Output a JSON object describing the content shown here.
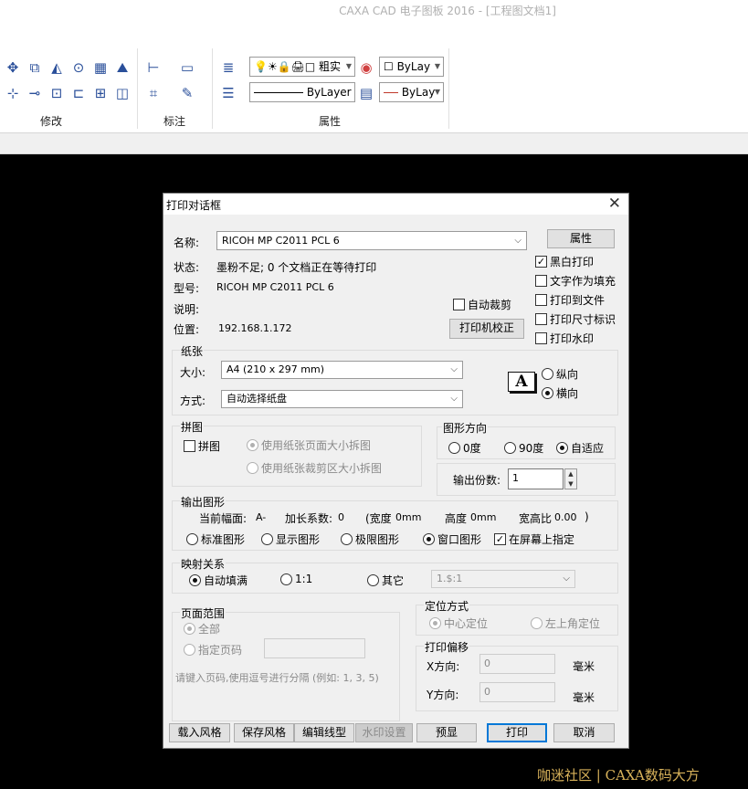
{
  "app": {
    "title": "CAXA CAD 电子图板 2016 - [工程图文档1]"
  },
  "ribbon": {
    "groups": {
      "modify": "修改",
      "dimension": "标注",
      "properties": "属性"
    },
    "linewidth_combo": "粗实",
    "color_combo": "ByLay",
    "linetype_combo": "ByLayer",
    "linecolor_combo": "ByLay"
  },
  "dialog": {
    "title": "打印对话框",
    "printer": {
      "name_label": "名称:",
      "name_value": "RICOH MP C2011 PCL 6",
      "status_label": "状态:",
      "status_value": "墨粉不足; 0 个文档正在等待打印",
      "model_label": "型号:",
      "model_value": "RICOH MP C2011 PCL 6",
      "desc_label": "说明:",
      "location_label": "位置:",
      "location_value": "192.168.1.172",
      "properties_button": "属性",
      "calibrate_button": "打印机校正",
      "auto_crop": "自动裁剪"
    },
    "options": {
      "bw_print": "黑白打印",
      "text_fill": "文字作为填充",
      "print_to_file": "打印到文件",
      "print_size_mark": "打印尺寸标识",
      "print_watermark": "打印水印"
    },
    "paper": {
      "title": "纸张",
      "size_label": "大小:",
      "size_value": "A4 (210 x 297 mm)",
      "source_label": "方式:",
      "source_value": "自动选择纸盘",
      "portrait": "纵向",
      "landscape": "横向",
      "orientation_icon": "A"
    },
    "tile": {
      "title": "拼图",
      "tile_check": "拼图",
      "by_paper": "使用纸张页面大小拆图",
      "by_crop": "使用纸张裁剪区大小拆图"
    },
    "rotation": {
      "title": "图形方向",
      "deg0": "0度",
      "deg90": "90度",
      "auto": "自适应"
    },
    "copies": {
      "label": "输出份数:",
      "value": "1"
    },
    "output": {
      "title": "输出图形",
      "current_label": "当前幅面:",
      "current_value": "A-",
      "extend_label": "加长系数:",
      "extend_value": "0",
      "width_label": "(宽度",
      "width_value": "0mm",
      "height_label": "高度",
      "height_value": "0mm",
      "ratio_label": "宽高比",
      "ratio_value": "0.00",
      "close_paren": ")",
      "standard": "标准图形",
      "display": "显示图形",
      "limits": "极限图形",
      "window": "窗口图形",
      "on_screen": "在屏幕上指定"
    },
    "mapping": {
      "title": "映射关系",
      "auto_fill": "自动填满",
      "one_to_one": "1:1",
      "other": "其它",
      "ratio_value": "1.$:1"
    },
    "page_range": {
      "title": "页面范围",
      "all": "全部",
      "specify": "指定页码",
      "hint": "请键入页码,使用逗号进行分隔 (例如: 1, 3, 5)"
    },
    "positioning": {
      "title": "定位方式",
      "center": "中心定位",
      "top_left": "左上角定位"
    },
    "offset": {
      "title": "打印偏移",
      "x_label": "X方向:",
      "x_value": "0",
      "y_label": "Y方向:",
      "y_value": "0",
      "unit": "毫米"
    },
    "buttons": {
      "load_style": "载入风格",
      "save_style": "保存风格",
      "edit_linetype": "编辑线型",
      "watermark_settings": "水印设置",
      "preview": "预显",
      "print": "打印",
      "cancel": "取消"
    }
  },
  "footer_watermark": "咖迷社区 | CAXA数码大方"
}
